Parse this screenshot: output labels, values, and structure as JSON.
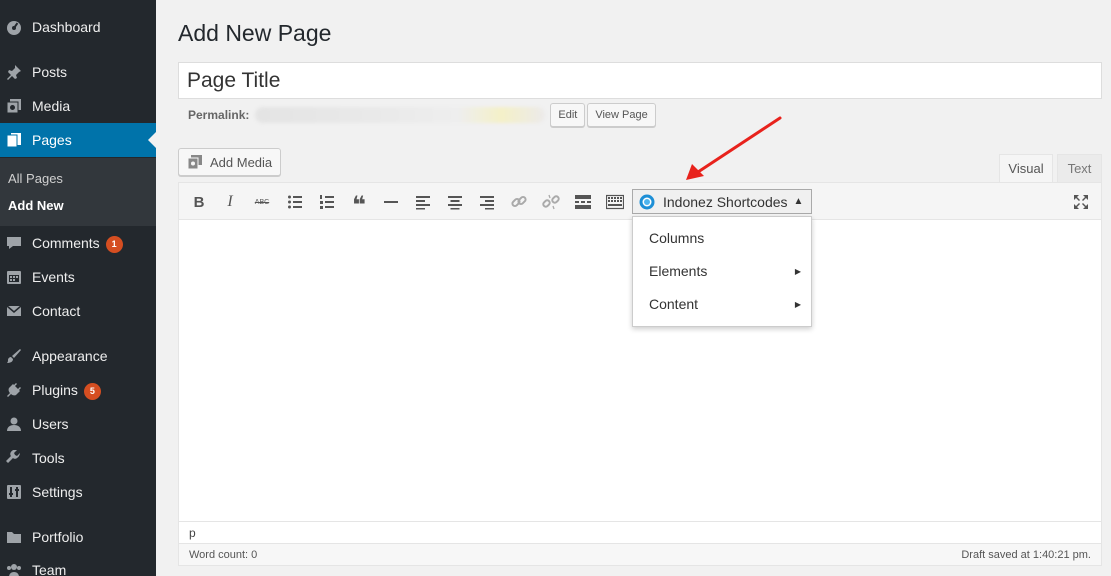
{
  "sidebar": {
    "items": [
      {
        "label": "Dashboard",
        "icon": "dashboard-icon"
      },
      {
        "label": "Posts",
        "icon": "pin-icon"
      },
      {
        "label": "Media",
        "icon": "media-icon"
      },
      {
        "label": "Pages",
        "icon": "pages-icon",
        "active": true
      },
      {
        "label": "Comments",
        "icon": "comment-icon",
        "badge": "1"
      },
      {
        "label": "Events",
        "icon": "calendar-icon"
      },
      {
        "label": "Contact",
        "icon": "mail-icon"
      },
      {
        "label": "Appearance",
        "icon": "brush-icon"
      },
      {
        "label": "Plugins",
        "icon": "plugin-icon",
        "badge": "5"
      },
      {
        "label": "Users",
        "icon": "user-icon"
      },
      {
        "label": "Tools",
        "icon": "wrench-icon"
      },
      {
        "label": "Settings",
        "icon": "settings-icon"
      },
      {
        "label": "Portfolio",
        "icon": "folder-icon"
      },
      {
        "label": "Team",
        "icon": "team-icon"
      }
    ],
    "submenu": [
      {
        "label": "All Pages"
      },
      {
        "label": "Add New",
        "current": true
      }
    ],
    "colors": {
      "background": "#23282d",
      "active": "#0073aa",
      "badge": "#d54e21"
    }
  },
  "main": {
    "title": "Add New Page",
    "title_input_value": "Page Title",
    "permalink_label": "Permalink:",
    "edit_button": "Edit",
    "view_page_button": "View Page",
    "add_media_button": "Add Media",
    "tabs": [
      {
        "label": "Visual",
        "active": true
      },
      {
        "label": "Text"
      }
    ]
  },
  "editor": {
    "toolbar": [
      {
        "name": "bold-button",
        "glyph": "B"
      },
      {
        "name": "italic-button",
        "glyph": "I"
      },
      {
        "name": "strikethrough-button",
        "glyph": "ABC"
      },
      {
        "name": "bullet-list-button",
        "glyph": ""
      },
      {
        "name": "numbered-list-button",
        "glyph": ""
      },
      {
        "name": "blockquote-button",
        "glyph": "❝"
      },
      {
        "name": "horizontal-line-button",
        "glyph": ""
      },
      {
        "name": "align-left-button",
        "glyph": ""
      },
      {
        "name": "align-center-button",
        "glyph": ""
      },
      {
        "name": "align-right-button",
        "glyph": ""
      },
      {
        "name": "insert-link-button",
        "glyph": ""
      },
      {
        "name": "unlink-button",
        "glyph": ""
      },
      {
        "name": "read-more-button",
        "glyph": ""
      },
      {
        "name": "toolbar-toggle-button",
        "glyph": ""
      }
    ],
    "shortcodes_label": "Indonez Shortcodes",
    "dropdown_items": [
      {
        "label": "Columns",
        "submenu": false
      },
      {
        "label": "Elements",
        "submenu": true
      },
      {
        "label": "Content",
        "submenu": true
      }
    ],
    "path": "p",
    "word_count": "Word count: 0",
    "draft_saved": "Draft saved at 1:40:21 pm."
  },
  "annotation": {
    "color": "#e8221c"
  }
}
